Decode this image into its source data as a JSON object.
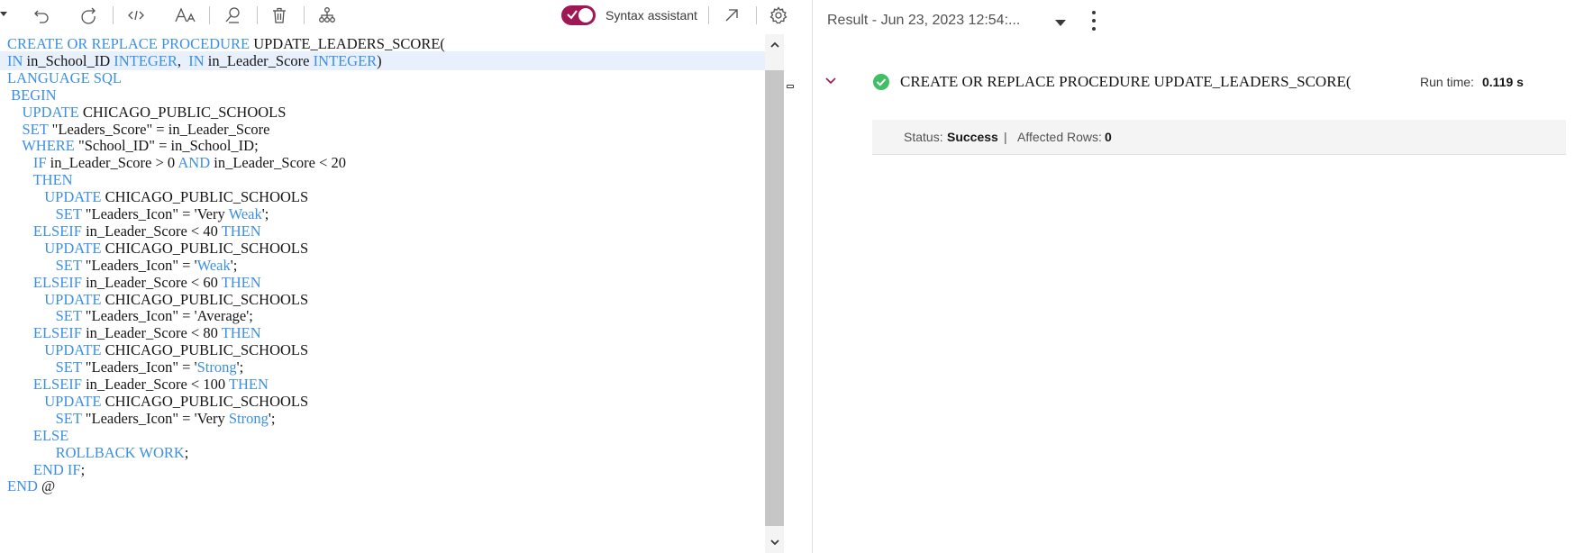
{
  "toolbar": {
    "icons": [
      "dropdown-caret",
      "undo-icon",
      "redo-icon",
      "code-icon",
      "font-size-icon",
      "find-icon",
      "delete-icon",
      "explain-tree-icon",
      "open-external-icon",
      "settings-icon"
    ],
    "syntax_assistant_label": "Syntax assistant",
    "syntax_assistant_enabled": true,
    "toggle_color": "#9f1853"
  },
  "editor": {
    "keyword_color": "#3d8fe5",
    "highlighted_line": 2,
    "lines": [
      "CREATE OR REPLACE PROCEDURE UPDATE_LEADERS_SCORE(",
      "IN in_School_ID INTEGER,  IN in_Leader_Score INTEGER)",
      "LANGUAGE SQL",
      " BEGIN",
      "    UPDATE CHICAGO_PUBLIC_SCHOOLS",
      "    SET \"Leaders_Score\" = in_Leader_Score",
      "    WHERE \"School_ID\" = in_School_ID;",
      "       IF in_Leader_Score > 0 AND in_Leader_Score < 20",
      "       THEN",
      "          UPDATE CHICAGO_PUBLIC_SCHOOLS",
      "             SET \"Leaders_Icon\" = 'Very Weak';",
      "       ELSEIF in_Leader_Score < 40 THEN",
      "          UPDATE CHICAGO_PUBLIC_SCHOOLS",
      "             SET \"Leaders_Icon\" = 'Weak';",
      "       ELSEIF in_Leader_Score < 60 THEN",
      "          UPDATE CHICAGO_PUBLIC_SCHOOLS",
      "             SET \"Leaders_Icon\" = 'Average';",
      "       ELSEIF in_Leader_Score < 80 THEN",
      "          UPDATE CHICAGO_PUBLIC_SCHOOLS",
      "             SET \"Leaders_Icon\" = 'Strong';",
      "       ELSEIF in_Leader_Score < 100 THEN",
      "          UPDATE CHICAGO_PUBLIC_SCHOOLS",
      "             SET \"Leaders_Icon\" = 'Very Strong';",
      "       ELSE",
      "             ROLLBACK WORK;",
      "       END IF;",
      "END @"
    ]
  },
  "result": {
    "title": "Result - Jun 23, 2023 12:54:...",
    "statement": "CREATE OR REPLACE PROCEDURE UPDATE_LEADERS_SCORE(",
    "runtime_label": "Run time:",
    "runtime_value": "0.119 s",
    "status_label": "Status:",
    "status_value": "Success",
    "separator": "|",
    "affected_label": "Affected Rows:",
    "affected_value": "0",
    "success_color": "#42be65"
  }
}
